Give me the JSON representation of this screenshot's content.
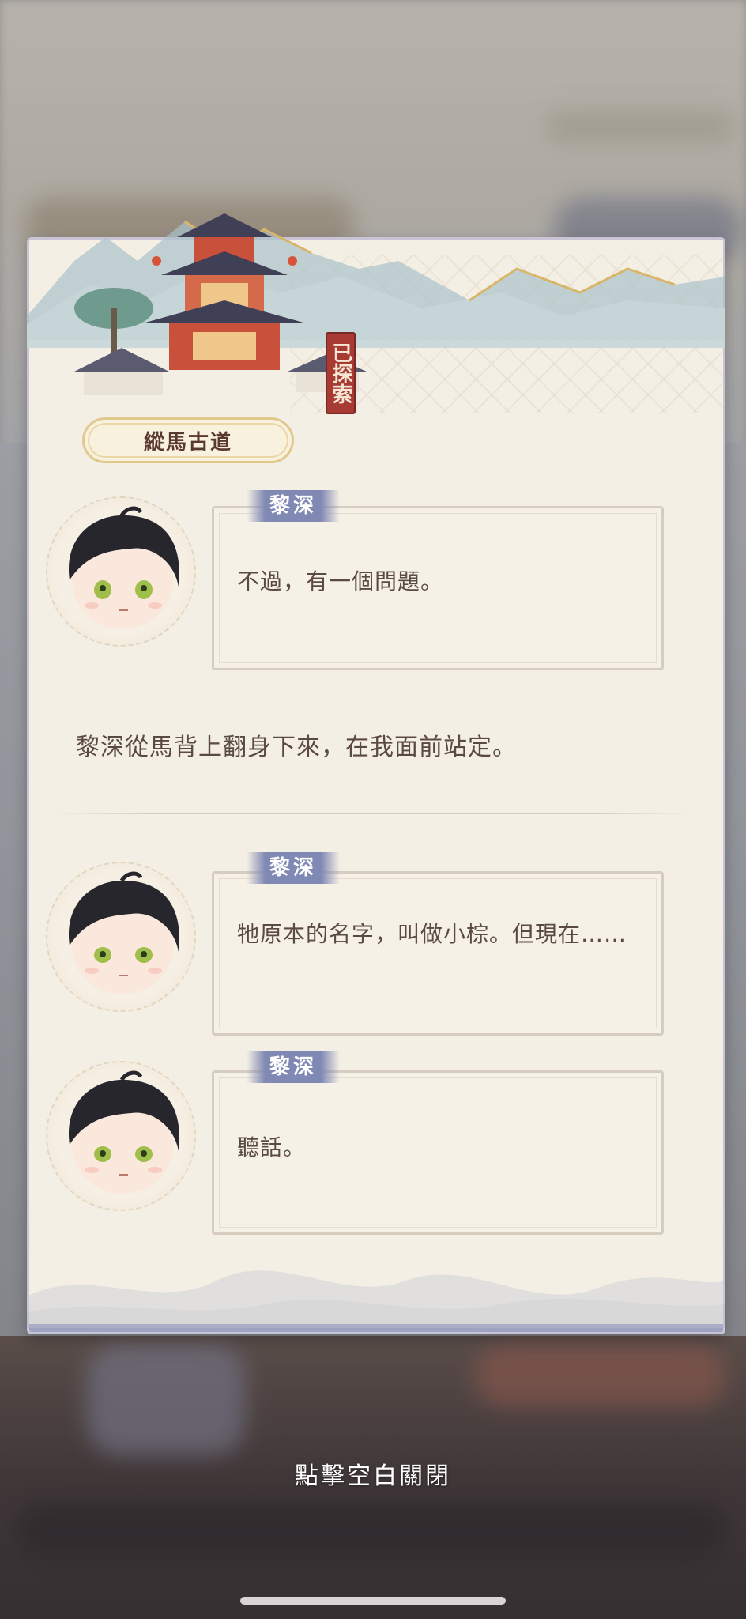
{
  "location": {
    "name": "縱馬古道",
    "status_seal": "已探索"
  },
  "dialogue": [
    {
      "speaker": "黎深",
      "text": "不過，有一個問題。"
    },
    {
      "narration": "黎深從馬背上翻身下來，在我面前站定。"
    },
    {
      "speaker": "黎深",
      "text": "牠原本的名字，叫做小棕。但現在……"
    },
    {
      "speaker": "黎深",
      "text": "聽話。"
    }
  ],
  "close_hint": "點擊空白關閉",
  "icons": {
    "avatar": "character-avatar-icon",
    "seal": "explored-seal-icon",
    "pavilion": "pavilion-illustration-icon"
  },
  "colors": {
    "speaker_tag": "#8089b4",
    "seal": "#a73b33",
    "card_bg": "#f4efe4",
    "text": "#5b4a44"
  }
}
